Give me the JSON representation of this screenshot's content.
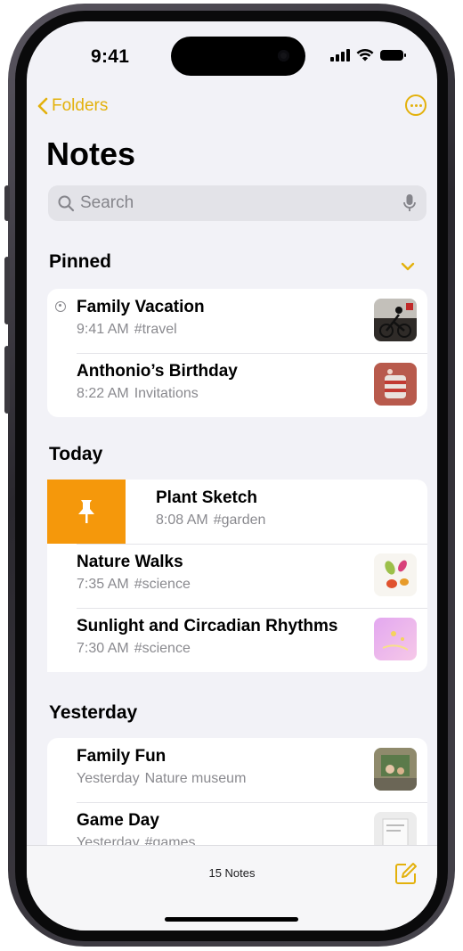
{
  "status": {
    "time": "9:41"
  },
  "nav": {
    "back_label": "Folders",
    "title": "Notes"
  },
  "search": {
    "placeholder": "Search"
  },
  "sections": {
    "pinned": "Pinned",
    "today": "Today",
    "yesterday": "Yesterday"
  },
  "pinned": [
    {
      "title": "Family Vacation",
      "time": "9:41 AM",
      "tag": "#travel"
    },
    {
      "title": "Anthonio’s Birthday",
      "time": "8:22 AM",
      "tag": "Invitations"
    }
  ],
  "today": [
    {
      "title": "Plant Sketch",
      "time": "8:08 AM",
      "tag": "#garden"
    },
    {
      "title": "Nature Walks",
      "time": "7:35 AM",
      "tag": "#science"
    },
    {
      "title": "Sunlight and Circadian Rhythms",
      "time": "7:30 AM",
      "tag": "#science"
    }
  ],
  "yesterday": [
    {
      "title": "Family Fun",
      "time": "Yesterday",
      "tag": "Nature museum"
    },
    {
      "title": "Game Day",
      "time": "Yesterday",
      "tag": "#games"
    }
  ],
  "toolbar": {
    "count": "15 Notes"
  },
  "colors": {
    "accent": "#e3b10c",
    "pin_action": "#f5980b",
    "background": "#f2f2f7"
  }
}
